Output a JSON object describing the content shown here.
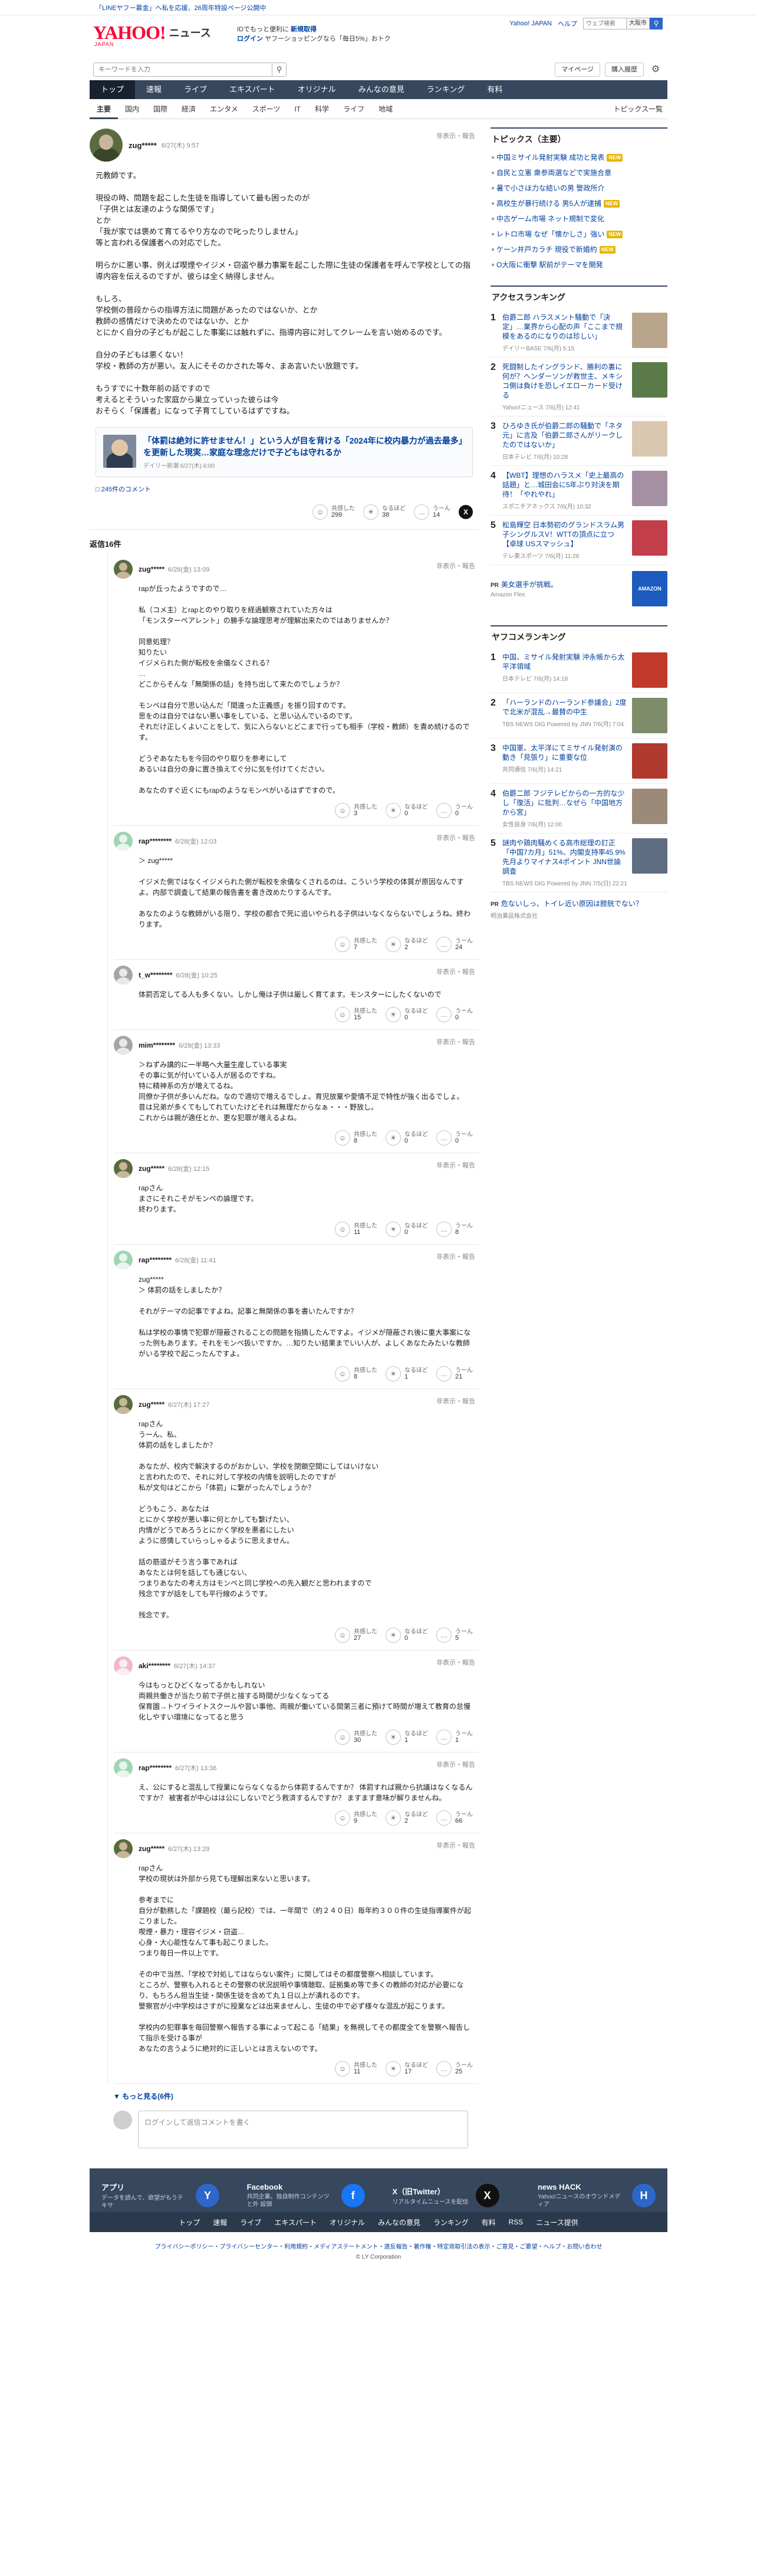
{
  "promo": {
    "text": "「LINEヤフー募金」へ私を応援、26周年特設ページ公開中"
  },
  "header": {
    "logo": "YAHOO!",
    "logo_sub": "JAPAN",
    "logo_news": "ニュース",
    "msg_line1_prefix": "IDでもっと便利に",
    "msg_line1_strong": "新規取得",
    "msg_login": "ログイン",
    "msg_line2": "ヤフーショッピングなら「毎日5%」おトク",
    "right_links": [
      "Yahoo! JAPAN",
      "ヘルプ"
    ],
    "site_search_placeholder": "ウェブ検索",
    "weather": "大阪市"
  },
  "search": {
    "placeholder": "キーワードを入力",
    "mypage": "マイページ",
    "subscribe": "購入履歴"
  },
  "nav": {
    "items": [
      "トップ",
      "速報",
      "ライブ",
      "エキスパート",
      "オリジナル",
      "みんなの意見",
      "ランキング",
      "有料"
    ],
    "active": 0
  },
  "subnav": {
    "items": [
      "主要",
      "国内",
      "国際",
      "経済",
      "エンタメ",
      "スポーツ",
      "IT",
      "科学",
      "ライフ",
      "地域"
    ],
    "right": "トピックス一覧"
  },
  "main_comment": {
    "user": "zug*****",
    "date": "6/27(木) 9:57",
    "report": "非表示・報告",
    "body": "元教師です。\n\n現役の時、問題を起こした生徒を指導していて最も困ったのが\n「子供とは友達のような関係です」\nとか\n「我が家では褒めて育てるやり方なので叱ったりしません」\n等と言われる保護者への対応でした。\n\n明らかに悪い事、例えば喫煙やイジメ・窃盗や暴力事案を起こした際に生徒の保護者を呼んで学校としての指導内容を伝えるのですが、彼らは全く納得しません。\n\nもしろ、\n学校側の普段からの指導方法に問題があったのではないか、とか\n教師の感情だけで決めたのではないか、とか\nとにかく自分の子どもが起こした事案には触れずに、指導内容に対してクレームを言い始めるのです。\n\n自分の子どもは悪くない！\n学校・教師の方が悪い。友人にそそのかされた等々、まあ言いたい放題です。\n\nもうすでに十数年前の話ですので\n考えるとそういった家庭から巣立っていった彼らは今\nおそらく「保護者」になって子育てしているはずですね。",
    "quote_title": "「体罰は絶対に許せません！」という人が目を背ける「2024年に校内暴力が過去最多」を更新した現実…家庭な理念だけで子どもは守れるか",
    "quote_src": "デイリー新潮 6/27(木) 6:00",
    "quote_more": "245件のコメント",
    "reactions": [
      {
        "label": "共感した",
        "count": "299"
      },
      {
        "label": "なるほど",
        "count": "38"
      },
      {
        "label": "うーん",
        "count": "14"
      }
    ]
  },
  "reply_header": {
    "prefix": "返信",
    "count": "16",
    "suffix": "件"
  },
  "replies": [
    {
      "user": "zug*****",
      "date": "6/28(金) 13:09",
      "avatar": "green",
      "body": "rapが丘ったようですので…\n\n私（コメ主）とrapとのやり取りを経過観察されていた方々は\n「モンスターペアレント」の勝手な論理思考が理解出来たのではありませんか？\n\n同意処理？\n知りたい\nイジメられた側が転校を余儀なくされる？\n…\nどこからそんな「無関係の話」を持ち出して来たのでしょうか？\n\nモンペは自分で思い込んだ「間違った正義感」を振り回すのです。\n思をのは自分ではない悪い事をしている、と思い込んでいるのです。\nそれだけ正しくよいことをして、気に入らないとどこまで行っても相手（学校・教師）を責め続けるのです。\n\nどうぞあなたもを今回のやり取りを参考にして\nあるいは自分の身に置き換えてぐ分に気を付けてください。\n\nあなたのすぐ近くにもrapのようなモンペがいるはずですので。",
      "reactions": [
        "3",
        "0",
        "0"
      ]
    },
    {
      "user": "rap********",
      "date": "6/28(金) 12:03",
      "avatar": "mint",
      "body": "＞ zug*****\n\nイジメた側ではなくイジメられた側が転校を余儀なくされるのは、こういう学校の体質が原因なんですよ。内部で調査して結果の報告書を書き改めたりするんです。\n\nあなたのような教師がいる限り、学校の都合で死に追いやられる子供はいなくならないでしょうね。終わります。",
      "reactions": [
        "7",
        "2",
        "24"
      ]
    },
    {
      "user": "t_w********",
      "date": "6/28(金) 10:25",
      "avatar": "gray",
      "body": "体罰否定してる人も多くない。しかし俺は子供は厳しく育てます。モンスターにしたくないので",
      "reactions": [
        "15",
        "0",
        "0"
      ]
    },
    {
      "user": "mim********",
      "date": "6/28(金) 13:33",
      "avatar": "gray",
      "body": "＞ねずみ講的に一半略へ大量生産している事実\nその事に気が付いている人が居るのですね。\n特に精神系の方が増えてるね。\n同僚か子供が多いんだね。なので適切で増えるでしょ。育児放棄や愛情不足で特性が強く出るでしょ。\n昔は兄弟が多くてもしてれていたけどそれは無理だからなぁ・・・野放し。\nこれからは親が適任とか、更な犯罪が増えるよね。",
      "reactions": [
        "8",
        "0",
        "0"
      ]
    },
    {
      "user": "zug*****",
      "date": "6/28(金) 12:15",
      "avatar": "green",
      "body": "rapさん\nまさにそれこそがモンペの論理です。\n終わります。",
      "reactions": [
        "11",
        "0",
        "8"
      ]
    },
    {
      "user": "rap********",
      "date": "6/28(金) 11:41",
      "avatar": "mint",
      "body": "zug*****\n＞ 体罰の話をしましたか？\n\nそれがテーマの記事ですよね。記事と無関係の事を書いたんですか？\n\n私は学校の事情で犯罪が隠蔽されることの問題を指摘したんですよ。イジメが隠蔽され後に重大事案になった例もあります。それをモンペ扱いですか。…知りたい結果までいい人が、よしくあなたみたいな教師がいる学校で起こったんですよ。",
      "reactions": [
        "8",
        "1",
        "21"
      ]
    },
    {
      "user": "zug*****",
      "date": "6/27(木) 17:27",
      "avatar": "green",
      "body": "rapさん\nうーん、私、\n体罰の話をしましたか？\n\nあなたが、校内で解決するのがおかしい、学校を閉鎖空間にしてはいけない\nと言われたので、それに対して学校の内情を説明したのですが\n私が文句はどこから「体罰」に繋がったんでしょうか？\n\nどうもこう、あなたは\nとにかく学校が悪い事に何とかしても繋げたい、\n内情がどうであろうとにかく学校を悪者にしたい\nように感情していらっしゃるように思えません。\n\n話の筋道がそう言う事であれば\nあなたとは何を話しても通じない、\nつまりあなたの考え方はモンペと同じ学校への先入観だと思われますので\n残念ですが話をしても平行線のようです。\n\n残念です。",
      "reactions": [
        "27",
        "0",
        "5"
      ]
    },
    {
      "user": "aki********",
      "date": "6/27(木) 14:37",
      "avatar": "pink",
      "body": "今はもっとひどくなってるかもしれない\n両親共働きが当たり前で子供と接する時間が少なくなってる\n保育園→トワイライトスクールや習い事他、両親が働いている間第三者に預けて時間が増えて教育の怠慢化しやすい環境になってると思う",
      "reactions": [
        "30",
        "1",
        "1"
      ]
    },
    {
      "user": "rap********",
      "date": "6/27(木) 13:36",
      "avatar": "mint",
      "body": "え、公にすると混乱して授業にならなくなるから体罰するんですか？ 体罰すれば親から抗議はなくなるんですか？ 被害者が中心はは公にしないでどう救済するんですか？ ますます意味が解りませんね。",
      "reactions": [
        "9",
        "2",
        "66"
      ]
    },
    {
      "user": "zug*****",
      "date": "6/27(木) 13:29",
      "avatar": "green",
      "body": "rapさん\n学校の現状は外部から見ても理解出来ないと思います。\n\n参考までに\n自分が勤務した「課題校（最ら記校）では、一年間で（約２４０日）毎年約３００件の生徒指導案件が起こりました。\n喫煙・暴力・理容イジメ・窃盗…\n心身・大心能性なんて事も起こりました。\nつまり毎日一件以上です。\n\nその中で当然、「学校で対処してはならない案件」に関してはその都度警察へ相談しています。\nところが、警察も入れるとその警察の状況説明や事情聴取、証拠集め等で多くの教師の対応が必要になり、もちろん担当生徒・関係生徒を含めて丸１日以上が潰れるのです。\n警察官が小中学校はさすがに授業などは出来ませんし、生徒の中で必ず様々な混乱が起こります。\n\n学校内の犯罪事を毎回警察へ報告する事によって起こる「結果」を無視してその都度全てを警察へ報告して指示を受ける事が\nあなたの言うように絶対的に正しいとは言えないのです。",
      "reactions": [
        "11",
        "17",
        "25"
      ]
    }
  ],
  "reaction_labels": [
    "共感した",
    "なるほど",
    "うーん"
  ],
  "more_replies": "もっと見る(6件)",
  "reply_form": {
    "placeholder": "ログインして返信コメントを書く"
  },
  "sidebar": {
    "topics_title": "トピックス（主要）",
    "topics": [
      {
        "text": "中国ミサイル発射実験 成功と発表",
        "badge": "NEW"
      },
      {
        "text": "自民と立憲 衆参両選などで実施合意",
        "badge": ""
      },
      {
        "text": "暑で小さほ力な結いの男 警政所介",
        "badge": ""
      },
      {
        "text": "高校生が暴行続ける 男5人が逮捕",
        "badge": "NEW"
      },
      {
        "text": "中古ゲーム市場 ネット規制で変化",
        "badge": ""
      },
      {
        "text": "レトロ市場 なぜ「懐かしさ」強い",
        "badge": "NEW"
      },
      {
        "text": "ケーン井戸カラチ 現役で新婚約",
        "badge": "NEW"
      },
      {
        "text": "O大阪に衝撃 駅前がテーマを開発",
        "badge": ""
      }
    ],
    "access_title": "アクセスランキング",
    "access": [
      {
        "title": "伯爵二郎 ハラスメント騒動で「決定」…業界から心配の声「ここまで規模をあるのになりのは珍しい」",
        "meta": "デイリーBASE 7/6(月) 5:15",
        "color": "#b9a58c"
      },
      {
        "title": "死闘制したイングランド、勝利の裏に何が？ヘンダーソンが救世主、メキシコ側は負けを恐しイエローカード受ける",
        "meta": "Yahoo!ニュース 7/6(月) 12:41",
        "color": "#5b7a4a"
      },
      {
        "title": "ひろゆき氏が伯爵二郎の騒動で「ネタ元」に言及「伯爵二郎さんがリークしたのではないか」",
        "meta": "日本テレビ 7/6(月) 10:28",
        "color": "#d9c7b0"
      },
      {
        "title": "【WBT】理想のハラスメ「史上最高の話題」と…城田会に5年ぶり対決を期待！「やれやれ」",
        "meta": "スポニチアネックス 7/6(月) 10:32",
        "color": "#a58fa3"
      },
      {
        "title": "松島輝空 日本勢初のグランドスラム男子シングルスV！WTTの頂点に立つ【卓球 USスマッシュ】",
        "meta": "テレ東スポーツ 7/6(月) 11:28",
        "color": "#c33e4b"
      }
    ],
    "pr1": {
      "label": "PR",
      "title": "美女選手が挑戦。",
      "sub": "Amazon Flex",
      "thumb": "AMAZON"
    },
    "yahoo_rank_title": "ヤフコメランキング",
    "yahoo_rank": [
      {
        "title": "中国、ミサイル発射実験 沖永帳から太平洋領域",
        "meta": "日本テレビ 7/6(月) 14:18",
        "color": "#c0392b"
      },
      {
        "title": "「ハーランドのハーランド参議会」2度で北米が混乱→最賛の中生",
        "meta": "TBS NEWS DIG Powered by JNN 7/6(月) 7:04",
        "color": "#7f8c6a"
      },
      {
        "title": "中国軍、太平洋にてミサイル発射演の動き「見張り」に重要な位",
        "meta": "共同通信 7/6(月) 14:21",
        "color": "#b03a2e"
      },
      {
        "title": "伯爵二郎 フジテレビからの一方的な少し「復活」に批判…なぜら「中国地方から宮」",
        "meta": "女性自身 7/6(月) 12:00",
        "color": "#9b8a78"
      },
      {
        "title": "謎肉や鶏肉騒めくる高市総理の訂正「中国7カ月」51%、内閣支持率45.9% 先月よりマイナス4ポイント JNN世論調査",
        "meta": "TBS NEWS DIG Powered by JNN 7/5(日) 22:21",
        "color": "#5e6d82"
      }
    ],
    "pr2": {
      "label": "PR",
      "title": "危ないしっ、トイレ近い原因は膀胱でない？",
      "sub": "明治薬品株式会社"
    }
  },
  "footer": {
    "apps": [
      {
        "name": "アプリ",
        "desc": "データを読んで、欲望がもうテキサ",
        "icon_color": "#2e67c8",
        "icon": "Y"
      },
      {
        "name": "Facebook",
        "desc": "共同企業。独自制作コンテンツと外 設頭",
        "icon_color": "#1877f2",
        "icon": "f"
      },
      {
        "name": "X（旧Twitter）",
        "desc": "リアルタイムニュースを配信",
        "icon_color": "#111111",
        "icon": "X"
      },
      {
        "name": "news HACK",
        "desc": "Yahoo!ニュースのオウンドメディア",
        "icon_color": "#2e67c8",
        "icon": "H"
      }
    ],
    "nav": [
      "トップ",
      "速報",
      "ライブ",
      "エキスパート",
      "オリジナル",
      "みんなの意見",
      "ランキング",
      "有料",
      "RSS",
      "ニュース提供"
    ],
    "links": "プライバシーポリシー・プライバシーセンター・利用規約・メディアステートメント・違反報告・著作権・特定商取引法の表示・ご意見・ご要望・ヘルプ・お問い合わせ",
    "copyright": "© LY Corporation"
  }
}
